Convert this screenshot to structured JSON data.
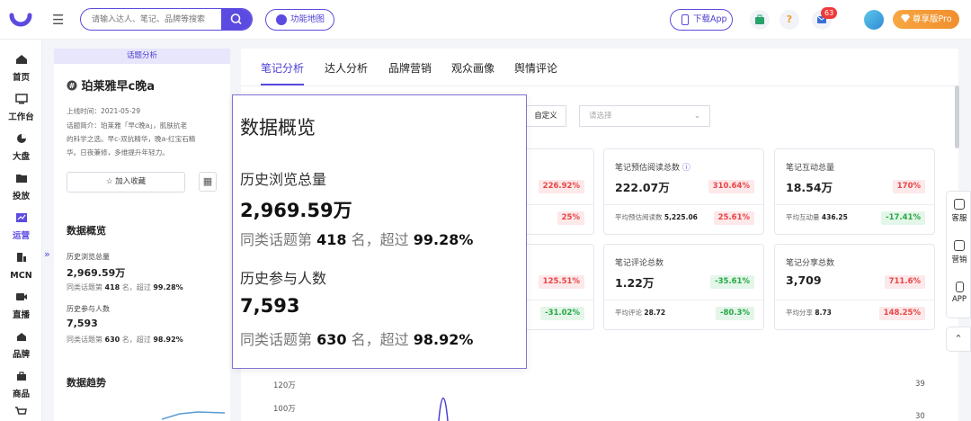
{
  "header": {
    "search_placeholder": "请输入达人、笔记、品牌等搜索",
    "feature_map": "功能地图",
    "download_app": "下载App",
    "help_symbol": "?",
    "message_badge": "63",
    "pro_label": "尊享版Pro",
    "accent_color": "#5b4be0"
  },
  "nav": {
    "items": [
      {
        "label": "首页",
        "icon": "home-icon"
      },
      {
        "label": "工作台",
        "icon": "workbench-icon"
      },
      {
        "label": "大盘",
        "icon": "pie-chart-icon"
      },
      {
        "label": "投放",
        "icon": "folder-icon"
      },
      {
        "label": "运营",
        "icon": "chart-icon"
      },
      {
        "label": "MCN",
        "icon": "building-icon"
      },
      {
        "label": "直播",
        "icon": "video-icon"
      },
      {
        "label": "品牌",
        "icon": "brand-icon"
      },
      {
        "label": "商品",
        "icon": "bag-icon"
      }
    ],
    "collapse_symbol": "»"
  },
  "topic": {
    "tab": "话题分析",
    "name": "珀莱雅早c晚a",
    "online_time": "上线时间：2021-05-29",
    "intro_line1": "话题简介：珀莱雅「早c晚a」，肌肤抗老",
    "intro_line2": "的科学之选。早c-双抗精华，晚a-红宝石精",
    "intro_line3": "华。日夜兼修，多维提升年轻力。",
    "favorite": "加入收藏",
    "overview_title": "数据概览",
    "views_label": "历史浏览总量",
    "views_value": "2,969.59万",
    "views_rank_prefix": "同类话题第",
    "views_rank": "418",
    "views_rank_mid": "名，超过",
    "views_pct": "99.28%",
    "participants_label": "历史参与人数",
    "participants_value": "7,593",
    "participants_rank_prefix": "同类话题第",
    "participants_rank": "630",
    "participants_rank_mid": "名，超过",
    "participants_pct": "98.92%",
    "trend_title": "数据趋势"
  },
  "tabs": [
    "笔记分析",
    "达人分析",
    "品牌营销",
    "观众画像",
    "舆情评论"
  ],
  "filters": {
    "custom": "自定义",
    "select_placeholder": "请选择"
  },
  "cards": [
    {
      "title": "",
      "value": "",
      "change": "226.92%",
      "sub_label": "",
      "sub_value": "",
      "sub_change": "25%"
    },
    {
      "title": "笔记预估阅读总数",
      "value": "222.07万",
      "change": "310.64%",
      "sub_label": "平均预估阅读数",
      "sub_value": "5,225.06",
      "sub_change": "25.61%"
    },
    {
      "title": "笔记互动总量",
      "value": "18.54万",
      "change": "170%",
      "sub_label": "平均互动量",
      "sub_value": "436.25",
      "sub_change": "-17.41%"
    },
    {
      "title": "",
      "value": "",
      "change": "125.51%",
      "sub_label": "",
      "sub_value": "",
      "sub_change": "-31.02%"
    },
    {
      "title": "笔记评论总数",
      "value": "1.22万",
      "change": "-35.61%",
      "sub_label": "平均评论",
      "sub_value": "28.72",
      "sub_change": "-80.3%"
    },
    {
      "title": "笔记分享总数",
      "value": "3,709",
      "change": "711.6%",
      "sub_label": "平均分享",
      "sub_value": "8.73",
      "sub_change": "148.25%"
    }
  ],
  "chart_axis": {
    "left": [
      "120万",
      "100万"
    ],
    "right": [
      "39",
      "30"
    ]
  },
  "floating": {
    "service": "客服",
    "marketing": "营销",
    "app": "APP",
    "top_symbol": "⌃"
  }
}
